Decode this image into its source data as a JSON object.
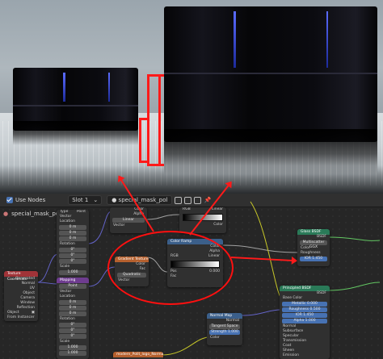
{
  "editor": {
    "use_nodes_label": "Use Nodes",
    "slot_label": "Slot 1",
    "material_name": "special_mask_pol",
    "breadcrumb": "special_mask_pol"
  },
  "nodes": {
    "texture_coordinate": {
      "title": "Texture Coordinate",
      "outputs": [
        "Generated",
        "Normal",
        "UV",
        "Object",
        "Camera",
        "Window",
        "Reflection"
      ],
      "object_label": "Object",
      "from_instancer": "From Instancer"
    },
    "mapping_top": {
      "title": "Mapping",
      "type_label": "Type",
      "type_value": "Point",
      "rows": [
        {
          "label": "Vector",
          "value": ""
        },
        {
          "label": "Location",
          "value": ""
        },
        {
          "label": "X",
          "value": "0 m"
        },
        {
          "label": "Y",
          "value": "0 m"
        },
        {
          "label": "Z",
          "value": "0 m"
        },
        {
          "label": "Rotation",
          "value": ""
        },
        {
          "label": "X",
          "value": "0°"
        },
        {
          "label": "Y",
          "value": "0°"
        },
        {
          "label": "Z",
          "value": "0°"
        },
        {
          "label": "Scale",
          "value": ""
        },
        {
          "label": "X",
          "value": "1.000"
        },
        {
          "label": "Y",
          "value": "1.000"
        },
        {
          "label": "Z",
          "value": "1.000"
        }
      ]
    },
    "mapping_bottom": {
      "title": "Mapping",
      "type_value": "Point",
      "rows": [
        {
          "label": "Vector",
          "value": ""
        },
        {
          "label": "Location",
          "value": ""
        },
        {
          "label": "X",
          "value": "0 m"
        },
        {
          "label": "Y",
          "value": "0 m"
        },
        {
          "label": "Z",
          "value": "0 m"
        },
        {
          "label": "Rotation",
          "value": ""
        },
        {
          "label": "X",
          "value": "0°"
        },
        {
          "label": "Y",
          "value": "0°"
        },
        {
          "label": "Z",
          "value": "0°"
        },
        {
          "label": "Scale",
          "value": ""
        },
        {
          "label": "X",
          "value": "1.000"
        },
        {
          "label": "Y",
          "value": "1.000"
        }
      ]
    },
    "image_texture_top": {
      "outputs": [
        "Color",
        "Alpha"
      ],
      "interpolation": "Linear",
      "input": "Vector"
    },
    "gradient_texture": {
      "title": "Gradient Texture",
      "outputs": [
        "Color",
        "Fac"
      ],
      "mode": "Quadratic",
      "input": "Vector"
    },
    "color_ramp_top": {
      "mode": "RGB",
      "interp": "Linear",
      "outputs": [
        "Color",
        "Alpha"
      ]
    },
    "color_ramp_main": {
      "title": "Color Ramp",
      "outputs": [
        "Color",
        "Alpha"
      ],
      "mode": "RGB",
      "interp": "Linear",
      "pos_label": "Pos",
      "pos_value": "0.000",
      "input": "Fac"
    },
    "glass_bsdf": {
      "title": "Glass BSDF",
      "output": "BSDF",
      "distribution": "Multiscatter GGX",
      "ior_mode": "GGX",
      "rows": [
        {
          "label": "Color",
          "value": ""
        },
        {
          "label": "Roughness",
          "value": ""
        },
        {
          "label": "IOR",
          "value": "1.450"
        },
        {
          "label": "Normal",
          "value": ""
        }
      ]
    },
    "principled_bsdf": {
      "title": "Principled BSDF",
      "output": "BSDF",
      "rows": [
        {
          "label": "Base Color",
          "value": ""
        },
        {
          "label": "Metallic",
          "value": "0.000"
        },
        {
          "label": "Roughness",
          "value": "0.500"
        },
        {
          "label": "IOR",
          "value": "1.450"
        },
        {
          "label": "Alpha",
          "value": "1.000"
        },
        {
          "label": "Normal",
          "value": ""
        },
        {
          "label": "Subsurface",
          "value": ""
        },
        {
          "label": "Specular",
          "value": ""
        },
        {
          "label": "Transmission",
          "value": ""
        },
        {
          "label": "Coat",
          "value": ""
        },
        {
          "label": "Sheen",
          "value": ""
        },
        {
          "label": "Emission",
          "value": ""
        }
      ]
    },
    "normal_map": {
      "title": "Normal Map",
      "output": "Normal",
      "space": "Tangent Space",
      "strength_label": "Strength",
      "strength_value": "1.000",
      "input": "Color"
    },
    "bottom_image": {
      "title": "modern_Polit_logo_Normal.png"
    }
  },
  "colors": {
    "annotation": "#ff1a1a",
    "header_vector": "#6e3c8f",
    "header_input": "#a03338",
    "header_texture": "#b5602e",
    "header_converter": "#3b5f8a",
    "header_shader": "#2a7a58"
  }
}
